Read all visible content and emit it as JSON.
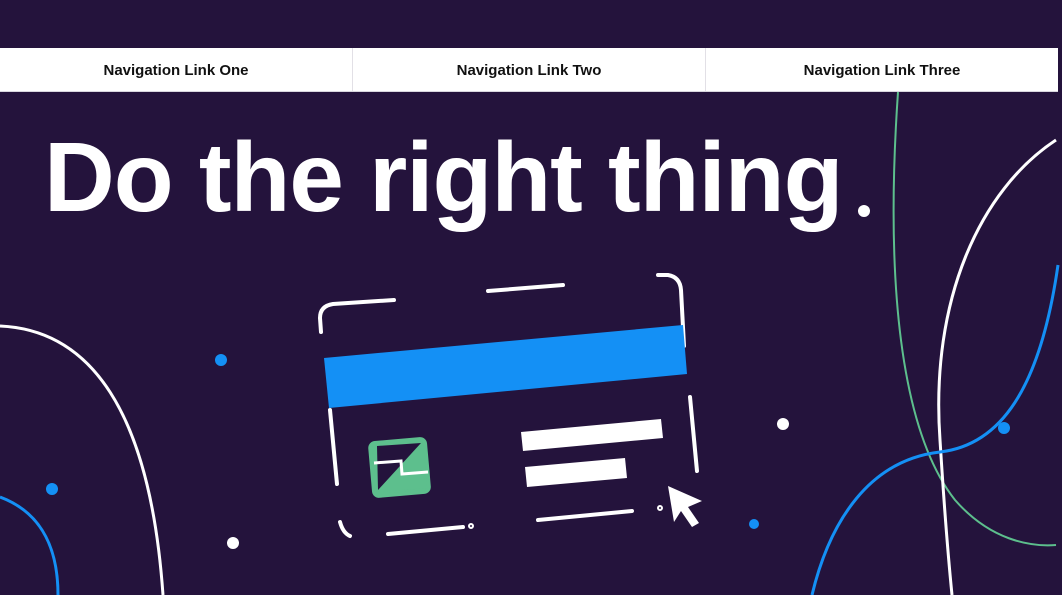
{
  "colors": {
    "background": "#24133c",
    "nav_background": "#ffffff",
    "accent_blue": "#1490f5",
    "accent_green": "#5dbf8d",
    "line_white": "#ffffff"
  },
  "nav": {
    "links": [
      {
        "label": "Navigation Link One"
      },
      {
        "label": "Navigation Link Two"
      },
      {
        "label": "Navigation Link Three"
      }
    ]
  },
  "hero": {
    "title": "Do the right thing"
  },
  "illustration": {
    "card_icon": "credit-card-illustration",
    "image_icon": "image-thumbnail-icon",
    "cursor_icon": "mouse-pointer-icon"
  }
}
